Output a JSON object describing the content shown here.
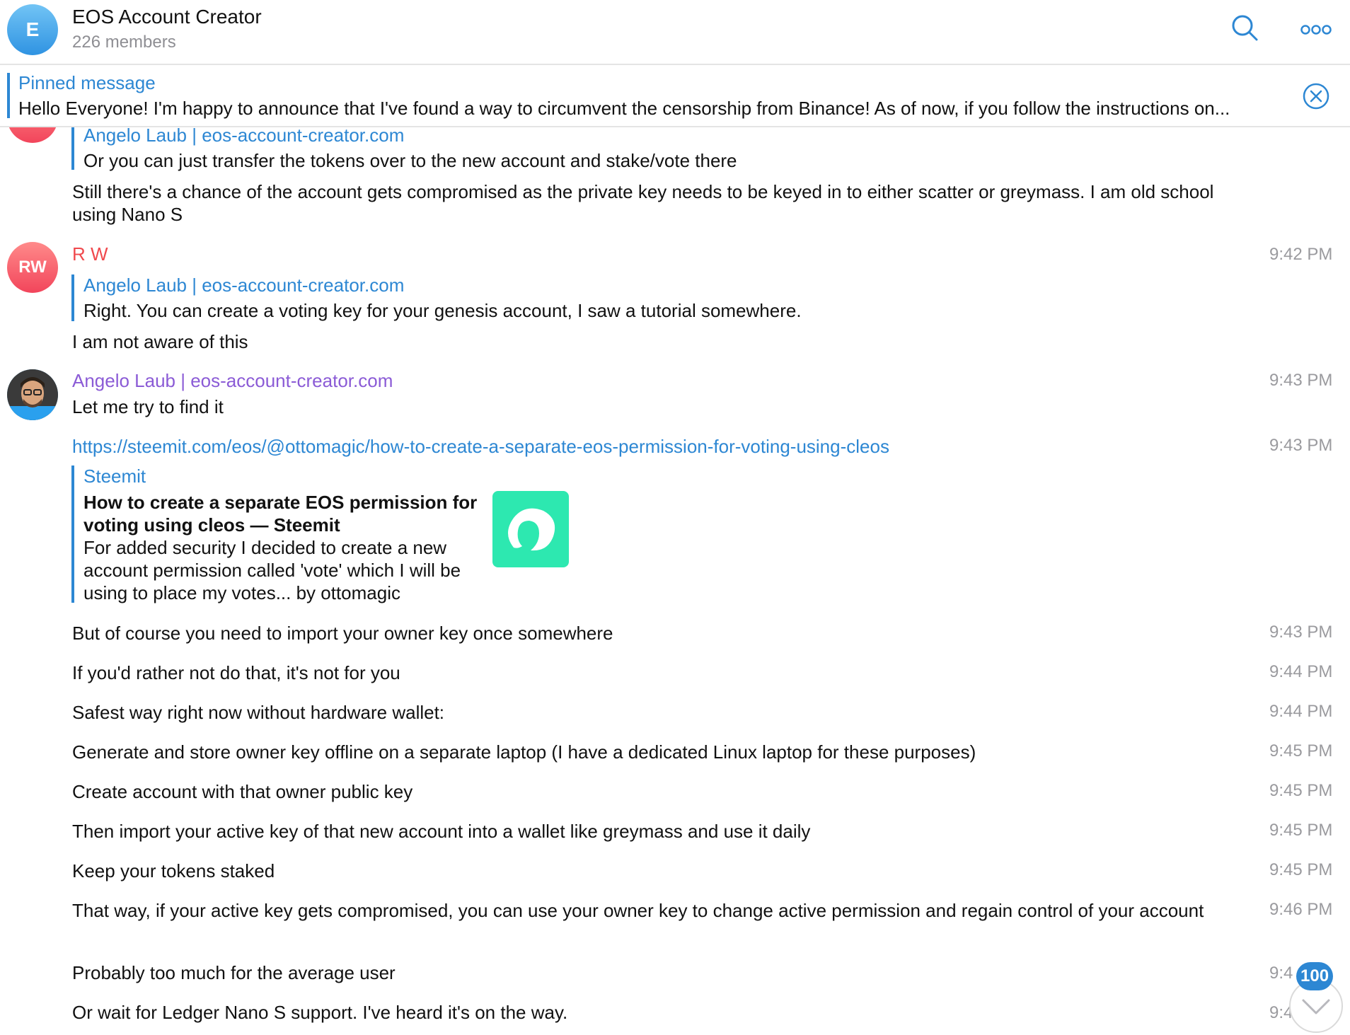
{
  "header": {
    "avatar_letter": "E",
    "title": "EOS Account Creator",
    "members": "226 members",
    "search_icon": "search-icon",
    "more_icon": "more-icon"
  },
  "pinned": {
    "title": "Pinned message",
    "text": "Hello Everyone! I'm happy to announce that I've found a way to circumvent the censorship from Binance! As of now, if you follow the instructions on...",
    "close_icon": "close-circle-icon"
  },
  "colors": {
    "accent": "#2d87d3",
    "rw_name": "#f0494d",
    "angelo_name": "#8b5bd6",
    "timestamp": "#9a9a9e",
    "steemit_green": "#2de8b0"
  },
  "messages": {
    "m0": {
      "reply_name": "Angelo Laub | eos-account-creator.com",
      "reply_text": "Or you can just transfer the tokens over to the new account and stake/vote there",
      "text": "Still there's a chance of the account gets compromised as the private key needs to be keyed in to either scatter or greymass. I am old school using Nano S"
    },
    "m1": {
      "avatar": "RW",
      "sender": "R W",
      "time": "9:42 PM",
      "reply_name": "Angelo Laub | eos-account-creator.com",
      "reply_text": "Right. You can create a voting key for your genesis account, I saw a tutorial somewhere.",
      "text": "I am not aware of this"
    },
    "m2": {
      "sender": "Angelo Laub | eos-account-creator.com",
      "time": "9:43 PM",
      "text": "Let me try to find it"
    },
    "m3": {
      "time": "9:43 PM",
      "link": "https://steemit.com/eos/@ottomagic/how-to-create-a-separate-eos-permission-for-voting-using-cleos",
      "preview_site": "Steemit",
      "preview_title": "How to create a separate EOS permission for voting using cleos — Steemit",
      "preview_desc": "For added security I decided to create a new account permission called 'vote' which I will be using to place my votes... by ottomagic"
    },
    "m4": {
      "text": "But of course you need to import your owner key once somewhere",
      "time": "9:43 PM"
    },
    "m5": {
      "text": "If you'd rather not do that, it's not for you",
      "time": "9:44 PM"
    },
    "m6": {
      "text": "Safest way right now without hardware wallet:",
      "time": "9:44 PM"
    },
    "m7": {
      "text": "Generate and store owner key offline on a separate laptop (I have a dedicated Linux laptop for these purposes)",
      "time": "9:45 PM"
    },
    "m8": {
      "text": "Create account with that owner public key",
      "time": "9:45 PM"
    },
    "m9": {
      "text": "Then import your active key of that new account into a wallet like greymass and use it daily",
      "time": "9:45 PM"
    },
    "m10": {
      "text": "Keep your tokens staked",
      "time": "9:45 PM"
    },
    "m11": {
      "text": "That way, if your active key gets compromised, you can use your owner key to change active permission and regain control of your account",
      "time": "9:46 PM"
    },
    "m12": {
      "text": "Probably too much for the average user",
      "time": "9:4"
    },
    "m13": {
      "text": "Or wait for Ledger Nano S support. I've heard it's on the way.",
      "time": "9:4"
    }
  },
  "scroll": {
    "unread_count": "100",
    "icon": "chevron-down-icon"
  }
}
